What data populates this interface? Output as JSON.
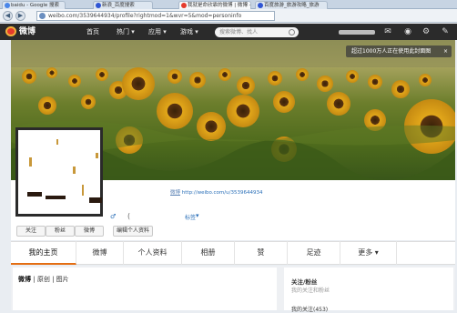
{
  "colors": {
    "weibo_nav_bg": "#2b2b2b",
    "weibo_red": "#e53b2c",
    "link_blue": "#2a6fb8",
    "active_tab_orange": "#e46e13"
  },
  "browser": {
    "tabs": [
      {
        "title": "baidu - Google 搜索",
        "icon": "google-favicon",
        "active": false
      },
      {
        "title": "新浪_百度搜索",
        "icon": "baidu-favicon",
        "active": false
      },
      {
        "title": "我就是命欣霏的微博 | 微博 -",
        "icon": "weibo-favicon",
        "active": true
      },
      {
        "title": "百度旅游_旅游攻略_旅游",
        "icon": "baidu-favicon",
        "active": false
      }
    ],
    "url": "weibo.com/3539644934/profile?rightmod=1&wvr=5&mod=personinfo"
  },
  "weibo_nav": {
    "logo": "微博",
    "items": [
      "首页",
      "热门 ▾",
      "应用 ▾",
      "游戏 ▾"
    ],
    "search_placeholder": "搜索微博、找人",
    "icons": [
      "message-icon",
      "bell-icon",
      "gear-icon",
      "edit-icon"
    ]
  },
  "banner": {
    "notice": "超过1000万人正在使用此封面图",
    "notice_close": "×"
  },
  "profile": {
    "link_prefix": "微博",
    "url": "http://weibo.com/u/3539644934",
    "gender_symbol": "♂",
    "intro_bracket": "(",
    "tag_label": "标签",
    "tag_chevron": "▾",
    "buttons": [
      "关注",
      "粉丝",
      "微博",
      "编辑个人资料"
    ]
  },
  "tabs": [
    "我的主页",
    "微博",
    "个人资料",
    "相册",
    "赞",
    "足迹",
    "更多 ▾"
  ],
  "feed_tabs": {
    "first": "微博",
    "sep1": "|",
    "second": "原创",
    "sep2": "|",
    "third": "图片"
  },
  "sidebar": {
    "title": "关注/粉丝",
    "subtitle": "我的关注和粉丝",
    "follow_count": "我的关注(453)"
  }
}
